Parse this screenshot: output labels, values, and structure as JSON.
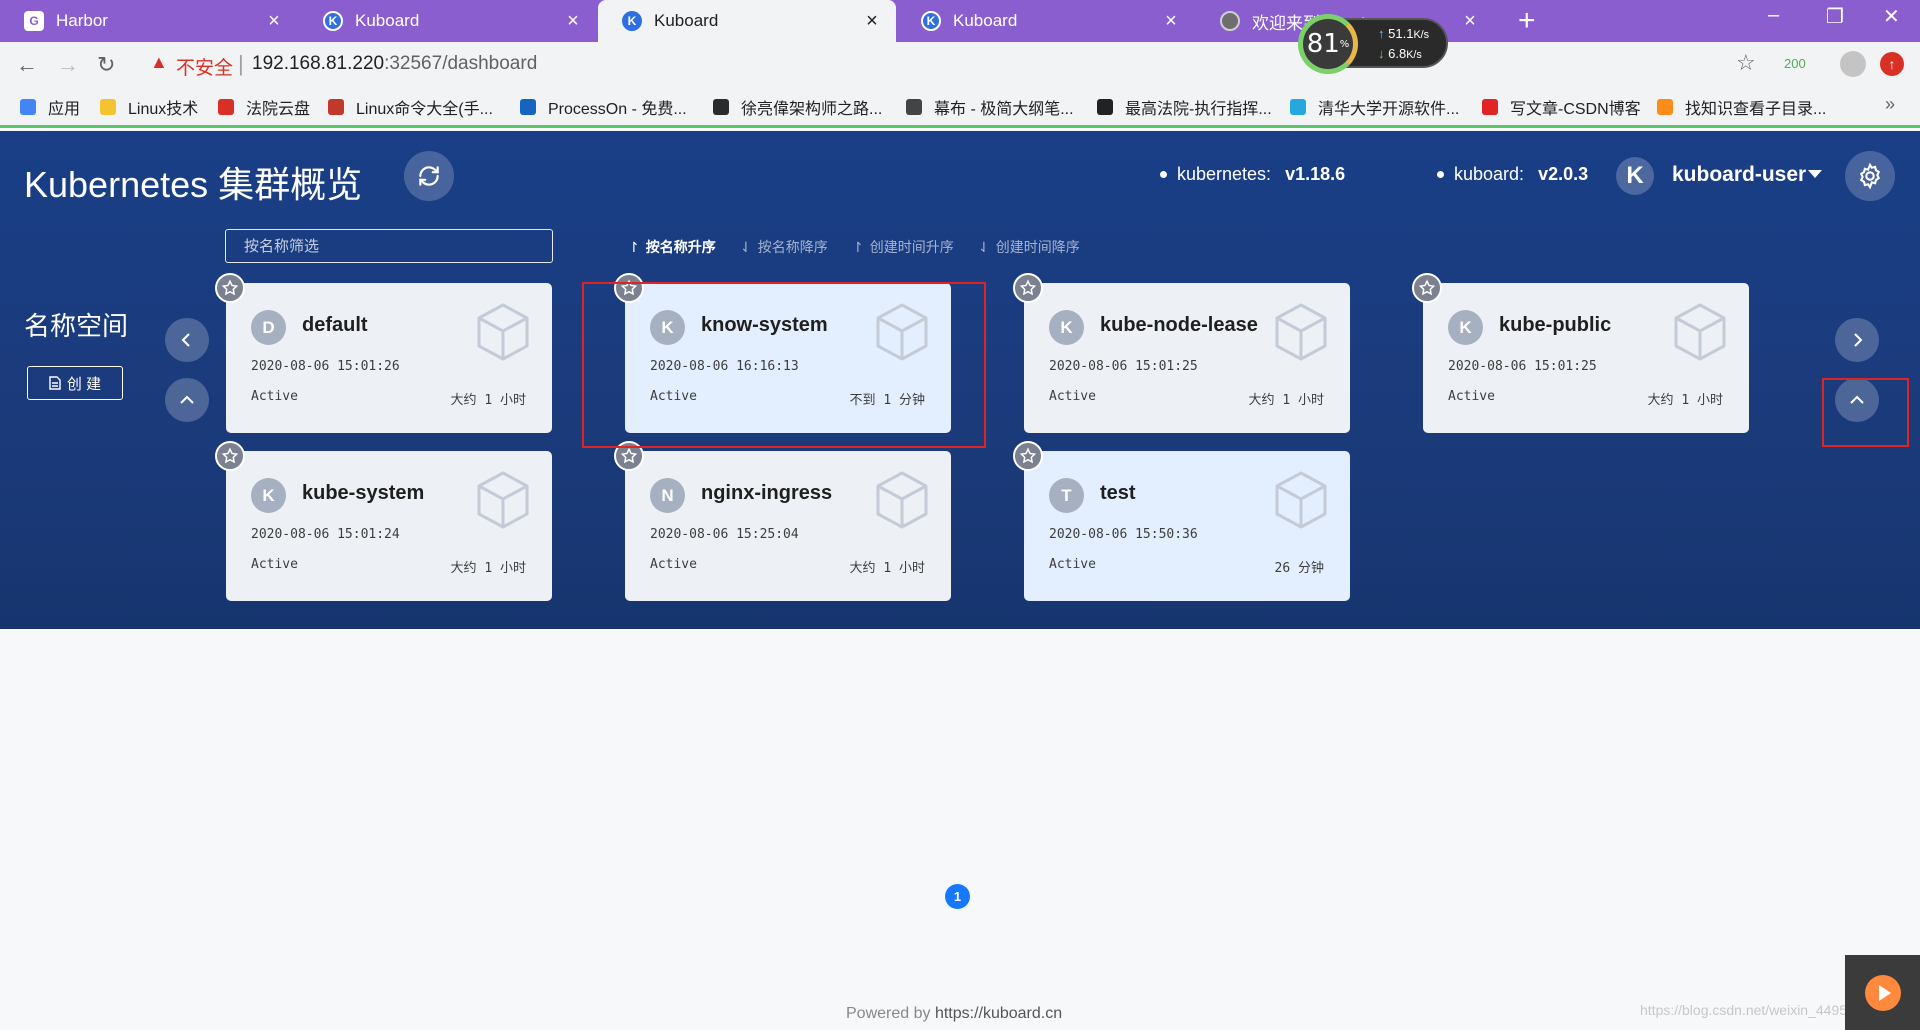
{
  "browser": {
    "tabs": [
      {
        "title": "Harbor",
        "icon": "harbor-icon",
        "active": false
      },
      {
        "title": "Kuboard",
        "icon": "kuboard-icon",
        "active": false
      },
      {
        "title": "Kuboard",
        "icon": "kuboard-icon",
        "active": true
      },
      {
        "title": "Kuboard",
        "icon": "kuboard-icon",
        "active": false
      },
      {
        "title": "欢迎来到nginx!",
        "icon": "globe-icon",
        "active": false
      }
    ],
    "speed": {
      "percent": "81",
      "unit": "%",
      "up": "51.1",
      "down": "6.8",
      "rate_unit": "K/s"
    },
    "insecure_label": "不安全",
    "url_host": "192.168.81.220",
    "url_rest": ":32567/dashboard",
    "extension_badge": "200",
    "bookmarks": [
      {
        "label": "应用",
        "color": "#4285f4"
      },
      {
        "label": "Linux技术",
        "color": "#f4c430"
      },
      {
        "label": "法院云盘",
        "color": "#d93025"
      },
      {
        "label": "Linux命令大全(手...",
        "color": "#c0392b"
      },
      {
        "label": "ProcessOn - 免费...",
        "color": "#1565c0"
      },
      {
        "label": "徐亮偉架构师之路...",
        "color": "#2b2b2b"
      },
      {
        "label": "幕布 - 极简大纲笔...",
        "color": "#444444"
      },
      {
        "label": "最高法院-执行指挥...",
        "color": "#222222"
      },
      {
        "label": "清华大学开源软件...",
        "color": "#26a7e0"
      },
      {
        "label": "写文章-CSDN博客",
        "color": "#e02424"
      },
      {
        "label": "找知识查看子目录...",
        "color": "#ff8c1a"
      }
    ]
  },
  "header": {
    "title": "Kubernetes 集群概览",
    "k8s_label": "kubernetes:",
    "k8s_version": "v1.18.6",
    "kuboard_label": "kuboard:",
    "kuboard_version": "v2.0.3",
    "user_initial": "K",
    "user_name": "kuboard-user"
  },
  "filter": {
    "placeholder": "按名称筛选"
  },
  "sort_options": [
    {
      "label": "按名称升序",
      "arrow": "↾",
      "active": true
    },
    {
      "label": "按名称降序",
      "arrow": "⇃",
      "active": false
    },
    {
      "label": "创建时间升序",
      "arrow": "↾",
      "active": false
    },
    {
      "label": "创建时间降序",
      "arrow": "⇃",
      "active": false
    }
  ],
  "namespace_section": {
    "label": "名称空间",
    "create_label": "创 建"
  },
  "namespaces": [
    {
      "initial": "D",
      "name": "default",
      "created": "2020-08-06 15:01:26",
      "status": "Active",
      "age": "大约 1 小时",
      "highlight": false
    },
    {
      "initial": "K",
      "name": "know-system",
      "created": "2020-08-06 16:16:13",
      "status": "Active",
      "age": "不到 1 分钟",
      "highlight": true
    },
    {
      "initial": "K",
      "name": "kube-node-lease",
      "created": "2020-08-06 15:01:25",
      "status": "Active",
      "age": "大约 1 小时",
      "highlight": false
    },
    {
      "initial": "K",
      "name": "kube-public",
      "created": "2020-08-06 15:01:25",
      "status": "Active",
      "age": "大约 1 小时",
      "highlight": false
    },
    {
      "initial": "K",
      "name": "kube-system",
      "created": "2020-08-06 15:01:24",
      "status": "Active",
      "age": "大约 1 小时",
      "highlight": false
    },
    {
      "initial": "N",
      "name": "nginx-ingress",
      "created": "2020-08-06 15:25:04",
      "status": "Active",
      "age": "大约 1 小时",
      "highlight": false
    },
    {
      "initial": "T",
      "name": "test",
      "created": "2020-08-06 15:50:36",
      "status": "Active",
      "age": "26 分钟",
      "highlight": true
    }
  ],
  "pagination": {
    "current_page": "1"
  },
  "footer": {
    "prefix": "Powered by ",
    "link": "https://kuboard.cn"
  },
  "watermark": "https://blog.csdn.net/weixin_44953658"
}
